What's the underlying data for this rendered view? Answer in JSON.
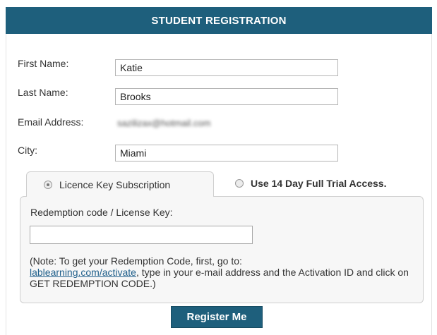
{
  "header": {
    "title": "STUDENT REGISTRATION"
  },
  "form": {
    "first_name_label": "First Name:",
    "first_name_value": "Katie",
    "last_name_label": "Last Name:",
    "last_name_value": "Brooks",
    "email_label": "Email Address:",
    "email_value": "sazilizax@hotmail.com",
    "city_label": "City:",
    "city_value": "Miami"
  },
  "tabs": {
    "licence_label": "Licence Key Subscription",
    "licence_selected": true,
    "trial_label": "Use 14 Day Full Trial Access.",
    "trial_selected": false
  },
  "panel": {
    "redemption_label": "Redemption code / License Key:",
    "redemption_value": "",
    "note_prefix": "(Note: To get your Redemption Code, first, go to:",
    "note_link": "lablearning.com/activate",
    "note_suffix": ", type in your e-mail address and the Activation ID and click on GET REDEMPTION CODE.)"
  },
  "actions": {
    "register_label": "Register Me"
  },
  "colors": {
    "header_bg": "#1e5f7c",
    "button_bg": "#1e5f7c",
    "link": "#1f5f8b"
  }
}
